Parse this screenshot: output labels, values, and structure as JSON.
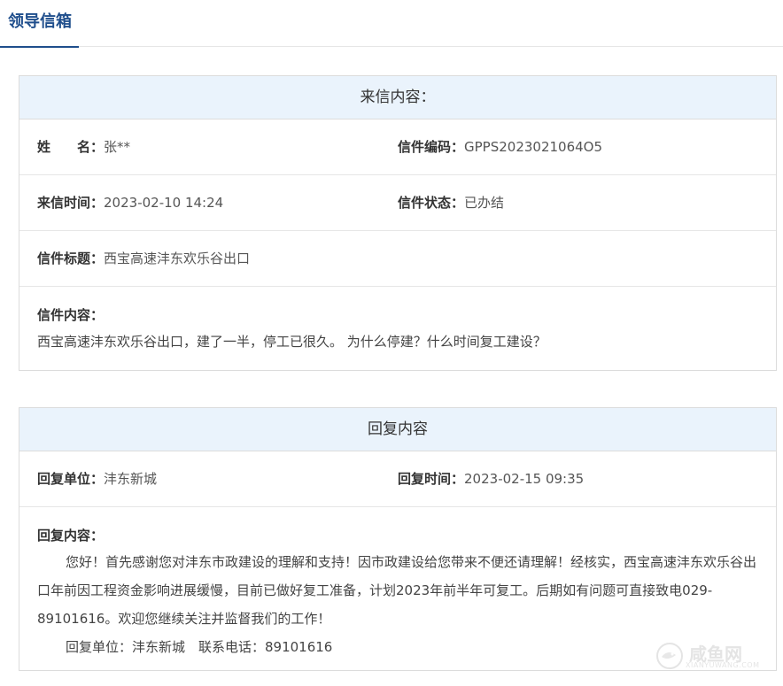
{
  "header": {
    "tab_label": "领导信箱"
  },
  "letter": {
    "title": "来信内容：",
    "name_label": "姓　　名：",
    "name_value": "张**",
    "code_label": "信件编码：",
    "code_value": "GPPS2023021064O5",
    "time_label": "来信时间：",
    "time_value": "2023-02-10 14:24",
    "status_label": "信件状态：",
    "status_value": "已办结",
    "subject_label": "信件标题：",
    "subject_value": "西宝高速沣东欢乐谷出口",
    "content_label": "信件内容：",
    "content_value": "西宝高速沣东欢乐谷出口，建了一半，停工已很久。 为什么停建？什么时间复工建设？"
  },
  "reply": {
    "title": "回复内容",
    "unit_label": "回复单位：",
    "unit_value": "沣东新城",
    "time_label": "回复时间：",
    "time_value": "2023-02-15 09:35",
    "content_label": "回复内容：",
    "content_value": "您好！首先感谢您对沣东市政建设的理解和支持！因市政建设给您带来不便还请理解！经核实，西宝高速沣东欢乐谷出口年前因工程资金影响进展缓慢，目前已做好复工准备，计划2023年前半年可复工。后期如有问题可直接致电029-89101616。欢迎您继续关注并监督我们的工作！",
    "signature": "回复单位：沣东新城　联系电话：89101616"
  },
  "watermark": {
    "main": "咸鱼网",
    "sub": "XIANYUWANG.COM"
  }
}
